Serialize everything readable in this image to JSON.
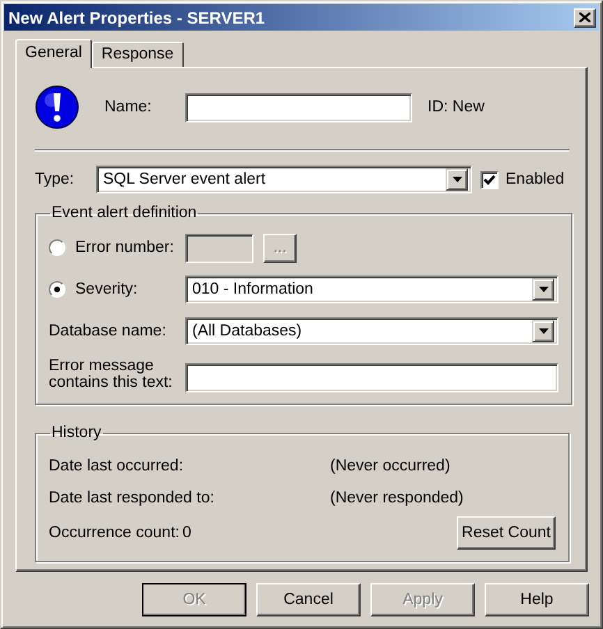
{
  "window": {
    "title": "New Alert Properties - SERVER1"
  },
  "tabs": [
    {
      "label": "General",
      "selected": true
    },
    {
      "label": "Response",
      "selected": false
    }
  ],
  "name_field": {
    "label": "Name:"
  },
  "id_text": "ID: New",
  "type": {
    "label": "Type:",
    "value": "SQL Server event alert"
  },
  "enabled": {
    "label": "Enabled",
    "checked": true
  },
  "event_definition": {
    "title": "Event alert definition",
    "criteria": [
      {
        "kind": "number",
        "label": "Error number:",
        "selected": false,
        "button": "..."
      },
      {
        "kind": "dropdown",
        "label": "Severity:",
        "selected": true,
        "value": "010 - Information"
      }
    ],
    "database": {
      "label": "Database name:",
      "value": "(All Databases)"
    },
    "message": {
      "label": "Error message contains this text:"
    }
  },
  "history": {
    "title": "History",
    "rows": [
      {
        "label": "Date last occurred:",
        "value": "(Never occurred)"
      },
      {
        "label": "Date last responded to:",
        "value": "(Never responded)"
      }
    ],
    "count": {
      "label": "Occurrence count:",
      "value": "0"
    },
    "reset_button": "Reset Count"
  },
  "buttons": [
    {
      "label": "OK",
      "disabled": true,
      "default": true
    },
    {
      "label": "Cancel",
      "disabled": false,
      "default": false
    },
    {
      "label": "Apply",
      "disabled": true,
      "default": false
    },
    {
      "label": "Help",
      "disabled": false,
      "default": false
    }
  ]
}
